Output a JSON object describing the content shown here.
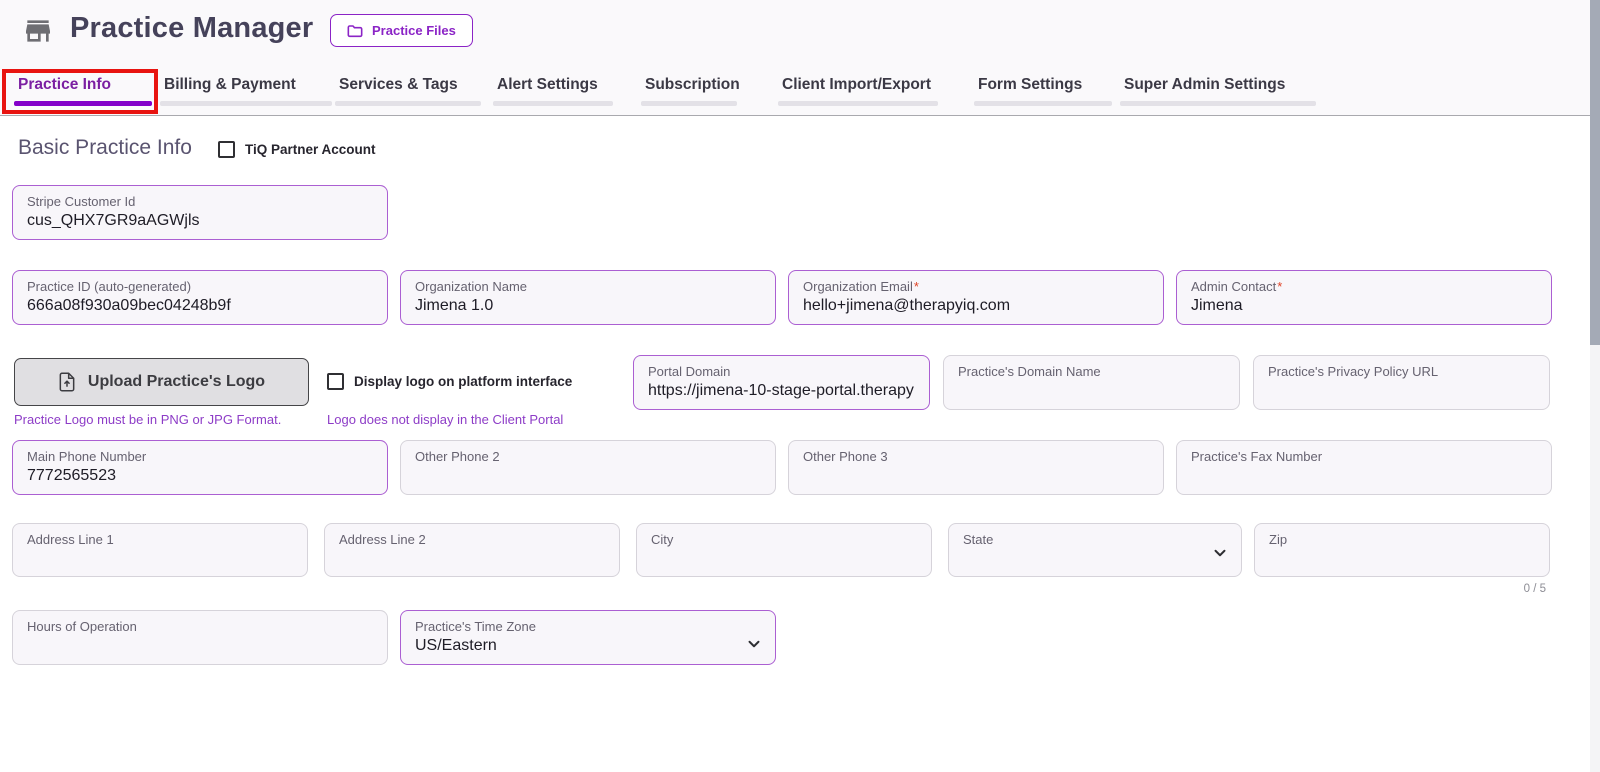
{
  "header": {
    "title": "Practice Manager",
    "practice_files_button": "Practice Files"
  },
  "tabs": [
    {
      "label": "Practice Info",
      "active": true,
      "annotated_with_red_box": true
    },
    {
      "label": "Billing & Payment"
    },
    {
      "label": "Services & Tags"
    },
    {
      "label": "Alert Settings"
    },
    {
      "label": "Subscription"
    },
    {
      "label": "Client Import/Export"
    },
    {
      "label": "Form Settings"
    },
    {
      "label": "Super Admin Settings"
    }
  ],
  "section": {
    "title": "Basic Practice Info",
    "tiq_partner_checkbox_label": "TiQ Partner Account",
    "tiq_partner_checked": false
  },
  "marks": {
    "required": "*"
  },
  "upload": {
    "button_label": "Upload Practice's Logo",
    "logo_format_hint": "Practice Logo must be in PNG or JPG Format.",
    "display_logo_checkbox_label": "Display logo on platform interface",
    "display_logo_checked": false,
    "display_logo_hint": "Logo does not display in the Client Portal"
  },
  "fields": {
    "stripe_customer_id": {
      "label": "Stripe Customer Id",
      "value": "cus_QHX7GR9aAGWjls"
    },
    "practice_id": {
      "label": "Practice ID (auto-generated)",
      "value": "666a08f930a09bec04248b9f"
    },
    "organization_name": {
      "label": "Organization Name",
      "value": "Jimena 1.0"
    },
    "organization_email": {
      "label": "Organization Email",
      "required": true,
      "value": "hello+jimena@therapyiq.com"
    },
    "admin_contact": {
      "label": "Admin Contact",
      "required": true,
      "value": "Jimena"
    },
    "portal_domain": {
      "label": "Portal Domain",
      "value": "https://jimena-10-stage-portal.therapy"
    },
    "practice_domain_name": {
      "label": "Practice's Domain Name",
      "value": ""
    },
    "privacy_policy_url": {
      "label": "Practice's Privacy Policy URL",
      "value": ""
    },
    "main_phone": {
      "label": "Main Phone Number",
      "value": "7772565523"
    },
    "other_phone_2": {
      "label": "Other Phone 2",
      "value": ""
    },
    "other_phone_3": {
      "label": "Other Phone 3",
      "value": ""
    },
    "fax_number": {
      "label": "Practice's Fax Number",
      "value": ""
    },
    "address_line_1": {
      "label": "Address Line 1",
      "value": ""
    },
    "address_line_2": {
      "label": "Address Line 2",
      "value": ""
    },
    "city": {
      "label": "City",
      "value": ""
    },
    "state": {
      "label": "State",
      "value": ""
    },
    "zip": {
      "label": "Zip",
      "value": "",
      "counter": "0 / 5"
    },
    "hours_of_operation": {
      "label": "Hours of Operation",
      "value": ""
    },
    "timezone": {
      "label": "Practice's Time Zone",
      "value": "US/Eastern"
    }
  },
  "icons": {
    "header": "storefront-icon",
    "practice_files": "folder-icon",
    "upload": "file-upload-icon",
    "selects": "chevron-down-icon"
  },
  "colors": {
    "accent_purple": "#8b24c6",
    "active_tab_text": "#7b1fa2",
    "active_tab_underline": "#8300c9",
    "field_border_purple": "#ab5fd2",
    "field_border_gray": "#d6d3da",
    "field_background": "#f8f6fa",
    "hint_purple": "#8d3cc7",
    "required_asterisk": "#e04326",
    "annotation_red": "#e81410",
    "header_background": "#faf9fb"
  }
}
